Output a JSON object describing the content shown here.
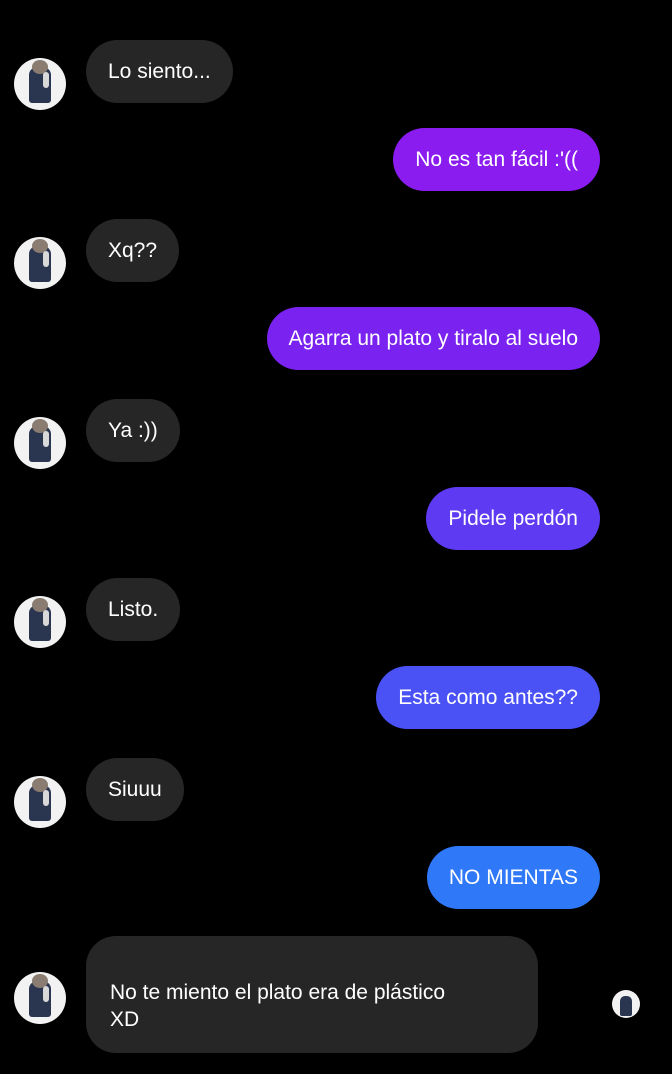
{
  "colors": {
    "background": "#000000",
    "incoming_bubble": "#262626",
    "outgoing_gradient": [
      "#8a1cf0",
      "#7a22f0",
      "#6a30f2",
      "#5a3ff4",
      "#4a52f6",
      "#2f78f8"
    ]
  },
  "messages": [
    {
      "side": "in",
      "text": "Lo siento..."
    },
    {
      "side": "out",
      "text": "No es tan fácil :'(("
    },
    {
      "side": "in",
      "text": "Xq??"
    },
    {
      "side": "out",
      "text": "Agarra un plato y tiralo al suelo"
    },
    {
      "side": "in",
      "text": "Ya :))"
    },
    {
      "side": "out",
      "text": "Pidele perdón"
    },
    {
      "side": "in",
      "text": "Listo."
    },
    {
      "side": "out",
      "text": "Esta como antes??"
    },
    {
      "side": "in",
      "text": "Siuuu"
    },
    {
      "side": "out",
      "text": "NO MIENTAS"
    },
    {
      "side": "in",
      "text": "No te miento el plato era de plástico\nXD"
    }
  ]
}
